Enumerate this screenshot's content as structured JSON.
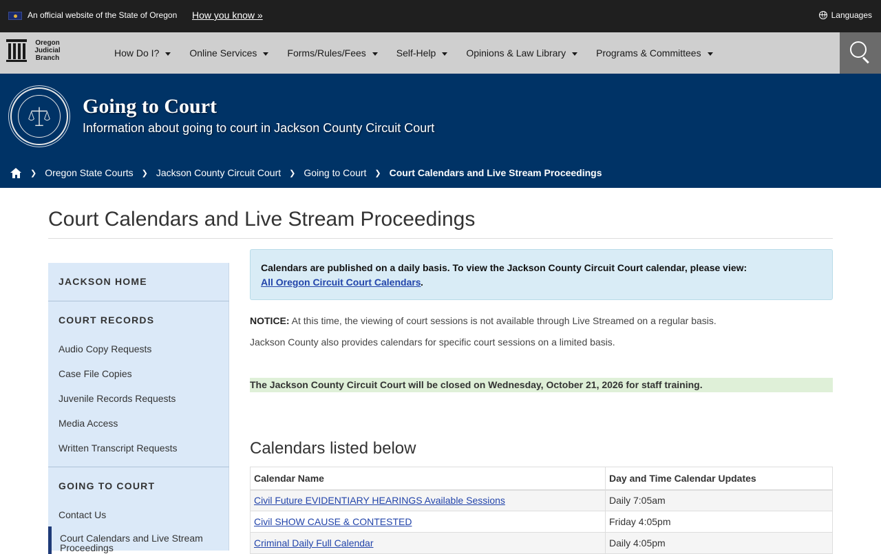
{
  "official_bar": {
    "text": "An official website of the State of Oregon",
    "how_link": "How you know »",
    "languages": "Languages"
  },
  "nav": {
    "logo_line1": "Oregon",
    "logo_line2": "Judicial",
    "logo_line3": "Branch",
    "items": [
      {
        "label": "How Do I?"
      },
      {
        "label": "Online Services"
      },
      {
        "label": "Forms/Rules/Fees"
      },
      {
        "label": "Self-Help"
      },
      {
        "label": "Opinions & Law Library"
      },
      {
        "label": "Programs & Committees"
      }
    ],
    "search_icon": "search-icon"
  },
  "banner": {
    "title": "Going to Court",
    "subtitle": "Information about going to court in Jackson County Circuit Court",
    "seal_icon": "judicial-department-seal",
    "breadcrumb": [
      {
        "label": "Oregon State Courts"
      },
      {
        "label": "Jackson County Circuit Court"
      },
      {
        "label": "Going to Court"
      },
      {
        "label": "Court Calendars and Live Stream Proceedings"
      }
    ]
  },
  "page": {
    "title": "Court Calendars and Live Stream Proceedings"
  },
  "sidebar": {
    "jackson_home": "JACKSON HOME",
    "court_records": "COURT RECORDS",
    "records_links": [
      {
        "label": "Audio Copy Requests"
      },
      {
        "label": "Case File Copies"
      },
      {
        "label": "Juvenile Records Requests"
      },
      {
        "label": "Media Access"
      },
      {
        "label": "Written Transcript Requests"
      }
    ],
    "going_to_court": "GOING TO COURT",
    "court_links": [
      {
        "label": "Contact Us"
      },
      {
        "label": "Court Calendars and Live Stream Proceedings"
      }
    ]
  },
  "content": {
    "info_text": "Calendars are published on a daily basis. To view the Jackson County Circuit Court calendar, please view:",
    "info_link": "All Oregon Circuit Court Calendars",
    "info_period": ".",
    "notice_label": "NOTICE:",
    "notice_text": " At this time, the viewing of court sessions is not available through Live Streamed on a regular basis.",
    "note2": "Jackson County also provides calendars for specific court sessions on a limited basis.",
    "alert": "The Jackson County Circuit Court will be closed on Wednesday, October 21, 2026 for staff training.",
    "calendars_heading": "Calendars listed below",
    "table": {
      "headers": [
        "Calendar Name",
        "Day and Time Calendar Updates"
      ],
      "rows": [
        {
          "name": "Civil Future EVIDENTIARY HEARINGS Available Sessions",
          "time": "Daily 7:05am"
        },
        {
          "name": "Civil SHOW CAUSE & CONTESTED",
          "time": "Friday 4:05pm"
        },
        {
          "name": "Criminal Daily Full Calendar",
          "time": "Daily 4:05pm"
        }
      ]
    }
  },
  "colors": {
    "top_bar": "#1f1f1f",
    "nav_bg": "#cfcfcf",
    "banner_bg": "#003366",
    "sidebar_bg": "#dbe9f8",
    "info_bg": "#d9ecf6",
    "alert_bg": "#dff0d8",
    "link": "#2244aa"
  }
}
